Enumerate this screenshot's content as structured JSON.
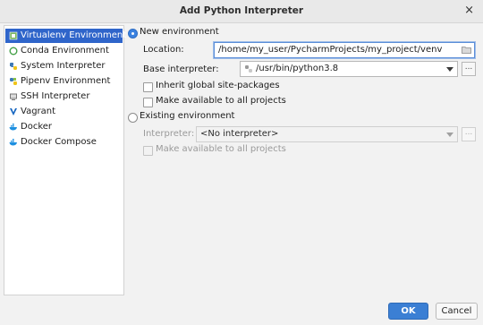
{
  "window": {
    "title": "Add Python Interpreter",
    "close_glyph": "×"
  },
  "sidebar": {
    "items": [
      {
        "label": "Virtualenv Environment",
        "icon": "virtualenv-icon",
        "selected": true
      },
      {
        "label": "Conda Environment",
        "icon": "conda-icon"
      },
      {
        "label": "System Interpreter",
        "icon": "python-icon"
      },
      {
        "label": "Pipenv Environment",
        "icon": "pipenv-icon"
      },
      {
        "label": "SSH Interpreter",
        "icon": "ssh-icon"
      },
      {
        "label": "Vagrant",
        "icon": "vagrant-icon"
      },
      {
        "label": "Docker",
        "icon": "docker-icon"
      },
      {
        "label": "Docker Compose",
        "icon": "docker-compose-icon"
      }
    ]
  },
  "new_env": {
    "label": "New environment",
    "location_label": "Location:",
    "location_value": "/home/my_user/PycharmProjects/my_project/venv",
    "base_label": "Base interpreter:",
    "base_value": "/usr/bin/python3.8",
    "inherit_label": "Inherit global site-packages",
    "make_available_label": "Make available to all projects",
    "browse_glyph": "..."
  },
  "existing_env": {
    "label": "Existing environment",
    "interpreter_label": "Interpreter:",
    "interpreter_value": "<No interpreter>",
    "make_available_label": "Make available to all projects",
    "browse_glyph": "..."
  },
  "buttons": {
    "ok": "OK",
    "cancel": "Cancel"
  }
}
